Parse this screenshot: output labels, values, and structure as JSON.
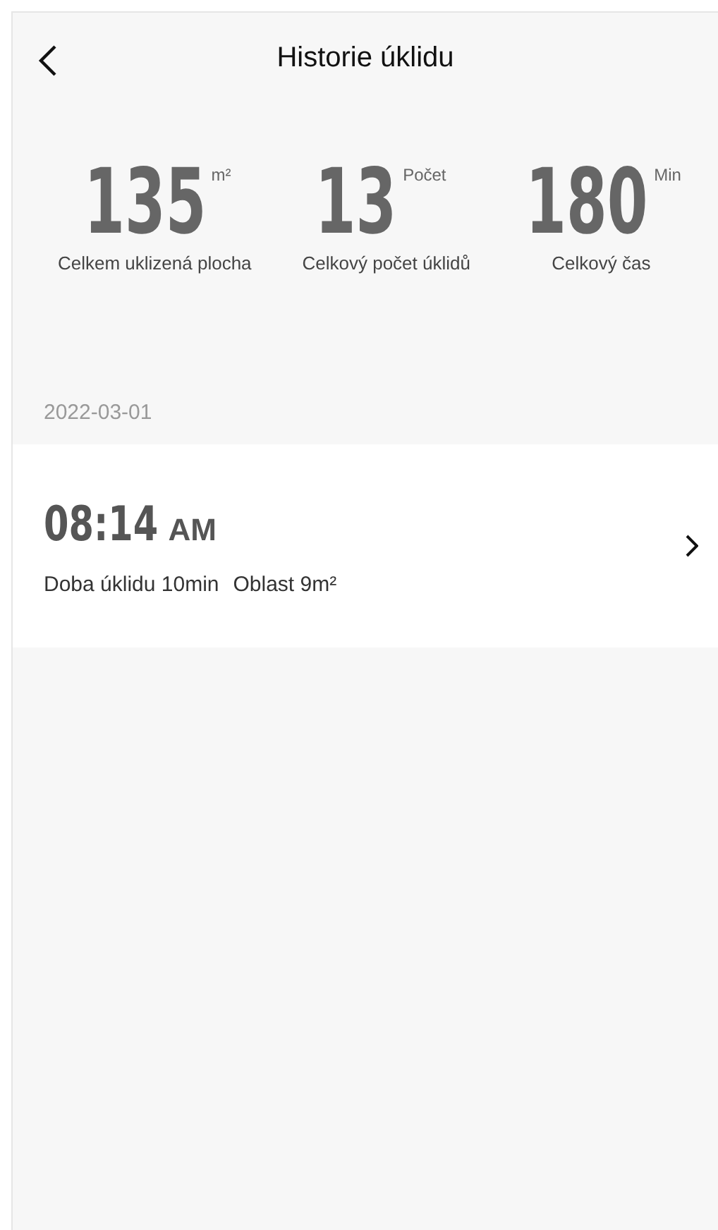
{
  "header": {
    "title": "Historie úklidu"
  },
  "stats": [
    {
      "value": "135",
      "unit": "m²",
      "label": "Celkem uklizená plocha"
    },
    {
      "value": "13",
      "unit": "Počet",
      "label": "Celkový počet úklidů"
    },
    {
      "value": "180",
      "unit": "Min",
      "label": "Celkový čas"
    }
  ],
  "groups": [
    {
      "date": "2022-03-01",
      "records": [
        {
          "time": "08:14",
          "ampm": "AM",
          "duration": "Doba úklidu 10min",
          "area": "Oblast 9m²"
        }
      ]
    }
  ]
}
